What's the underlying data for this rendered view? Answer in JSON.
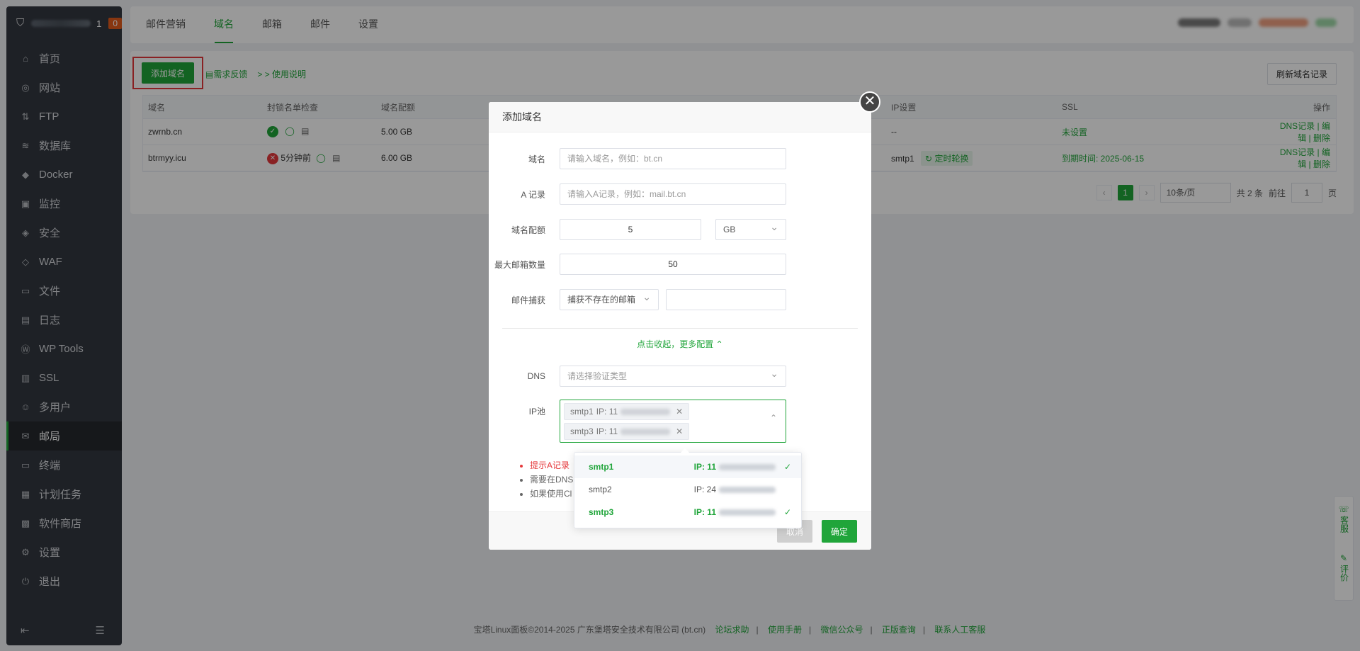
{
  "sidebar": {
    "server_number": "1",
    "badge": "0",
    "items": [
      {
        "label": "首页",
        "icon": "home-icon",
        "glyph": "⌂"
      },
      {
        "label": "网站",
        "icon": "globe-icon",
        "glyph": "◎"
      },
      {
        "label": "FTP",
        "icon": "ftp-icon",
        "glyph": "⇅"
      },
      {
        "label": "数据库",
        "icon": "database-icon",
        "glyph": "≋"
      },
      {
        "label": "Docker",
        "icon": "docker-icon",
        "glyph": "◆"
      },
      {
        "label": "监控",
        "icon": "monitor-icon",
        "glyph": "▣"
      },
      {
        "label": "安全",
        "icon": "shield-icon",
        "glyph": "◈"
      },
      {
        "label": "WAF",
        "icon": "waf-icon",
        "glyph": "◇"
      },
      {
        "label": "文件",
        "icon": "folder-icon",
        "glyph": "▭"
      },
      {
        "label": "日志",
        "icon": "log-icon",
        "glyph": "▤"
      },
      {
        "label": "WP Tools",
        "icon": "wordpress-icon",
        "glyph": "Ⓦ"
      },
      {
        "label": "SSL",
        "icon": "ssl-icon",
        "glyph": "▥"
      },
      {
        "label": "多用户",
        "icon": "users-icon",
        "glyph": "☺"
      },
      {
        "label": "邮局",
        "icon": "mail-icon",
        "glyph": "✉",
        "active": true
      },
      {
        "label": "终端",
        "icon": "terminal-icon",
        "glyph": "▭"
      },
      {
        "label": "计划任务",
        "icon": "calendar-icon",
        "glyph": "▦"
      },
      {
        "label": "软件商店",
        "icon": "store-icon",
        "glyph": "▩"
      },
      {
        "label": "设置",
        "icon": "gear-icon",
        "glyph": "⚙"
      },
      {
        "label": "退出",
        "icon": "logout-icon",
        "glyph": "⏻"
      }
    ]
  },
  "top_tabs": [
    "邮件营销",
    "域名",
    "邮箱",
    "邮件",
    "设置"
  ],
  "active_tab": 1,
  "toolbar": {
    "add_domain": "添加域名",
    "feedback": "需求反馈",
    "usage": "> > 使用说明",
    "refresh": "刷新域名记录"
  },
  "table": {
    "headers": [
      "域名",
      "封锁名单检查",
      "域名配额",
      "IP设置",
      "SSL",
      "操作"
    ],
    "rows": [
      {
        "domain": "zwrnb.cn",
        "check": "",
        "quota": "5.00 GB",
        "ip": "--",
        "ip_tag": "",
        "ssl": "未设置",
        "actions": [
          "DNS记录",
          "编辑",
          "删除"
        ]
      },
      {
        "domain": "btrmyy.icu",
        "check": "5分钟前",
        "quota": "6.00 GB",
        "ip": "smtp1",
        "ip_tag": "定时轮换",
        "ssl": "到期时间: 2025-06-15",
        "actions": [
          "DNS记录",
          "编辑",
          "删除"
        ]
      }
    ]
  },
  "pager": {
    "current": "1",
    "per_page": "10条/页",
    "total": "共 2 条",
    "goto_label": "前往",
    "goto_value": "1",
    "page_suffix": "页"
  },
  "modal": {
    "title": "添加域名",
    "fields": {
      "domain_label": "域名",
      "domain_placeholder": "请输入域名，例如：bt.cn",
      "a_label": "A 记录",
      "a_placeholder": "请输入A记录，例如：mail.bt.cn",
      "quota_label": "域名配额",
      "quota_value": "5",
      "quota_unit": "GB",
      "max_label": "最大邮箱数量",
      "max_value": "50",
      "catch_label": "邮件捕获",
      "catch_value": "捕获不存在的邮箱",
      "toggle": "点击收起，更多配置",
      "dns_label": "DNS",
      "dns_placeholder": "请选择验证类型",
      "ippool_label": "IP池",
      "chips": [
        {
          "name": "smtp1",
          "ip_prefix": "IP: 11"
        },
        {
          "name": "smtp3",
          "ip_prefix": "IP: 11"
        }
      ]
    },
    "notes": [
      "提示A记录",
      "需要在DNS",
      "如果使用Cl"
    ],
    "cancel": "取消",
    "confirm": "确定"
  },
  "dropdown": [
    {
      "name": "smtp1",
      "ip": "IP: 11",
      "selected": true
    },
    {
      "name": "smtp2",
      "ip": "IP: 24",
      "selected": false
    },
    {
      "name": "smtp3",
      "ip": "IP: 11",
      "selected": true
    }
  ],
  "footer": {
    "copyright": "宝塔Linux面板©2014-2025 广东堡塔安全技术有限公司 (bt.cn)",
    "links": [
      "论坛求助",
      "使用手册",
      "微信公众号",
      "正版查询",
      "联系人工客服"
    ]
  },
  "side_float": [
    "客服",
    "评价"
  ],
  "colors": {
    "accent": "#20a53a",
    "sidebar": "#333840",
    "danger": "#e5383b"
  }
}
